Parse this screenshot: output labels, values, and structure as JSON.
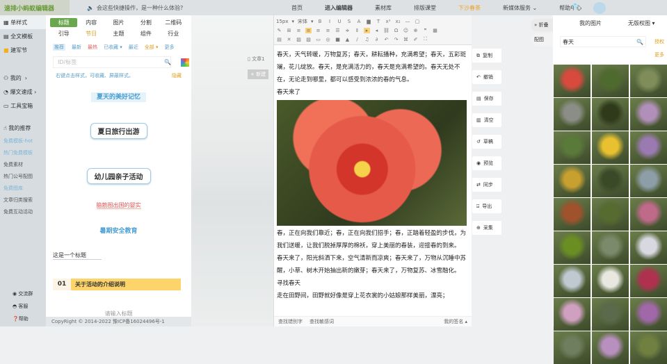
{
  "header": {
    "logo": "速排小蚂蚁编辑器",
    "notice": "会这些快捷操作，是一种什么体验?",
    "nav": [
      "首页",
      "进入编辑器",
      "素材库",
      "排版课堂",
      "下沙春茶",
      "新媒体服务 ⌄",
      "帮助中心"
    ]
  },
  "sidebar": {
    "items": [
      "单样式",
      "全文模板",
      "建军节",
      "我的",
      "爆文速成",
      "工具宝箱",
      "我的推荐"
    ],
    "links": [
      "免费模板-hot",
      "热门免费模板",
      "免费素材",
      "热门公号配图",
      "免费图库",
      "文章归类搜索",
      "免费互动活动"
    ],
    "bottom": [
      "交流群",
      "客服",
      "帮助"
    ]
  },
  "panel": {
    "tabs": [
      "标题",
      "内容",
      "图片",
      "分割",
      "二维码",
      "引导",
      "节日",
      "主题",
      "组件",
      "行业"
    ],
    "filters": [
      "推荐",
      "最新",
      "最热",
      "已收藏 ▾",
      "最近",
      "全部 ▾",
      "更多"
    ],
    "search_placeholder": "ID/标签",
    "tip": "右键点击样式，可收藏、屏蔽样式。",
    "tip_right": "隐藏",
    "styles": [
      "夏天的美好记忆",
      "夏日旅行出游",
      "幼儿园亲子活动",
      "脑筋图出国的婴实",
      "暑期安全教育",
      "这是一个标题",
      "01",
      "关于活动的介绍说明",
      "请输入标题"
    ],
    "copyright": "CopyRight © 2014-2022 豫ICP备16024496号-1"
  },
  "doc": {
    "tab": "文章1",
    "new": "+ 新建"
  },
  "editor": {
    "font_size": "15px",
    "font": "宋体",
    "paragraphs": [
      "春天，天气转暖，万物复苏；春天，耕耘播种，充满希望；春天，五彩斑斓，花儿绽放。春天，是充满活力的，春天是充满希望的。春天无处不在，无论走到哪里，都可以感受到浓浓的春的气息。",
      "春天来了",
      "春，正在向我们靠近；春，正在向我们招手；春，正踏着轻盈的步伐，为我们送暖，让我们脱掉厚厚的棉袄，穿上美丽的春装，迎接春的到来。",
      "春天来了，阳光斜洒下来，空气清新而凉爽；春天来了，万物从沉睡中苏醒，小草、树木开始抽出新的嫩芽；春天来了，万物复苏、冰雪融化。",
      "寻找春天",
      "走在田野间，田野就好像是穿上花衣裳的小姑娘那样美丽，漂亮；"
    ],
    "footer": [
      "查找错别字",
      "查找敏感词",
      "我的签名 ▴"
    ]
  },
  "actions": [
    "复制",
    "撤销",
    "保存",
    "清空",
    "草稿",
    "预览",
    "同步",
    "导出",
    "采集"
  ],
  "fold": [
    "» 折叠",
    "配图"
  ],
  "pictures": {
    "tabs": [
      "我的图片",
      "无版权图 ▾"
    ],
    "search": "春天",
    "right_links": [
      "授权",
      "更多"
    ],
    "thumbs": [
      "#d94a3e",
      "#4f6a2e",
      "#7e8d5a",
      "#8b8e86",
      "#2e3a1a",
      "#b08fb8",
      "#5a7a3a",
      "#e8c030",
      "#9a7ab0",
      "#c8a030",
      "#3a4a28",
      "#8e9ea8",
      "#a0522d",
      "#556b2f",
      "#c06a8a",
      "#6b8e23",
      "#7a8a6a",
      "#d8d8e0",
      "#c0c8d0",
      "#e8e8e0",
      "#b03050",
      "#d0a0c0",
      "#5a6a4a",
      "#a068a8",
      "#6e7e5e",
      "#b890c0",
      "#708040"
    ]
  }
}
